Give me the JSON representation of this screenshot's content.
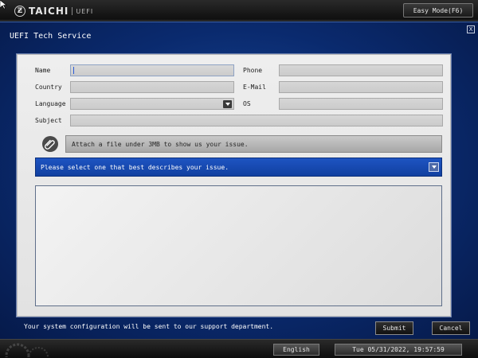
{
  "topbar": {
    "brand": "TAICHI",
    "brand_sub": "UEFI",
    "logo_icon": "taichi-logo-icon",
    "easy_mode_label": "Easy Mode(F6)"
  },
  "dialog": {
    "title": "UEFI Tech Service",
    "close_label": "X"
  },
  "form": {
    "name_label": "Name",
    "name_value": "",
    "phone_label": "Phone",
    "phone_value": "",
    "country_label": "Country",
    "country_value": "",
    "email_label": "E-Mail",
    "email_value": "",
    "language_label": "Language",
    "language_value": "",
    "os_label": "OS",
    "os_value": "",
    "subject_label": "Subject",
    "subject_value": ""
  },
  "attach": {
    "icon": "paperclip-icon",
    "label": "Attach a file under 3MB to show us your issue."
  },
  "issue_select": {
    "placeholder": "Please select one that best describes your issue."
  },
  "description": {
    "value": ""
  },
  "footer": {
    "notice": "Your system configuration will be sent to our support department.",
    "submit_label": "Submit",
    "cancel_label": "Cancel"
  },
  "bottombar": {
    "language": "English",
    "datetime": "Tue 05/31/2022, 19:57:59"
  },
  "colors": {
    "dialog_bg": "#0a2a6e",
    "panel_bg": "#e6e6e6",
    "issue_bar": "#1a4db8",
    "accent_caret": "#2a5bd7"
  }
}
